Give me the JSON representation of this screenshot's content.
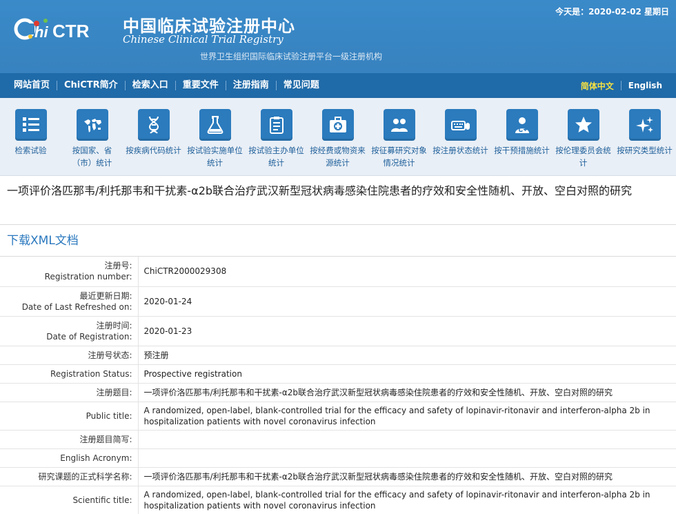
{
  "header": {
    "logo_text": "ChiCTR",
    "title_cn": "中国临床试验注册中心",
    "title_en": "Chinese Clinical Trial Registry",
    "subtitle": "世界卫生组织国际临床试验注册平台一级注册机构",
    "date_line": "今天是：2020-02-02 星期日"
  },
  "nav": {
    "items": [
      "网站首页",
      "ChiCTR简介",
      "检索入口",
      "重要文件",
      "注册指南",
      "常见问题"
    ],
    "lang_cn": "简体中文",
    "lang_en": "English"
  },
  "iconbar": {
    "items": [
      {
        "label": "检索试验",
        "icon": "list-icon"
      },
      {
        "label": "按国家、省（市）统计",
        "icon": "world-map-icon"
      },
      {
        "label": "按疾病代码统计",
        "icon": "dna-icon"
      },
      {
        "label": "按试验实施单位统计",
        "icon": "flask-icon"
      },
      {
        "label": "按试验主办单位统计",
        "icon": "clipboard-icon"
      },
      {
        "label": "按经费或物资来源统计",
        "icon": "medkit-icon"
      },
      {
        "label": "按征募研究对象情况统计",
        "icon": "people-icon"
      },
      {
        "label": "按注册状态统计",
        "icon": "keyboard-mouse-icon"
      },
      {
        "label": "按干预措施统计",
        "icon": "doctor-icon"
      },
      {
        "label": "按伦理委员会统计",
        "icon": "star-icon"
      },
      {
        "label": "按研究类型统计",
        "icon": "sparkle-icon"
      }
    ]
  },
  "page": {
    "title": "一项评价洛匹那韦/利托那韦和干扰素-α2b联合治疗武汉新型冠状病毒感染住院患者的疗效和安全性随机、开放、空白对照的研究",
    "download_label": "下载XML文档"
  },
  "rows": [
    {
      "label_cn": "注册号:",
      "label_en": "Registration number:",
      "value": "ChiCTR2000029308"
    },
    {
      "label_cn": "最近更新日期:",
      "label_en": "Date of Last Refreshed on:",
      "value": "2020-01-24"
    },
    {
      "label_cn": "注册时间:",
      "label_en": "Date of Registration:",
      "value": "2020-01-23"
    },
    {
      "label_cn": "注册号状态:",
      "label_en": "",
      "value": "预注册"
    },
    {
      "label_cn": "",
      "label_en": "Registration Status:",
      "value": "Prospective registration"
    },
    {
      "label_cn": "注册题目:",
      "label_en": "",
      "value": "一项评价洛匹那韦/利托那韦和干扰素-α2b联合治疗武汉新型冠状病毒感染住院患者的疗效和安全性随机、开放、空白对照的研究"
    },
    {
      "label_cn": "",
      "label_en": "Public title:",
      "value": "A randomized, open-label, blank-controlled trial for the efficacy and safety of lopinavir-ritonavir and interferon-alpha 2b in hospitalization patients with novel coronavirus infection"
    },
    {
      "label_cn": "注册题目简写:",
      "label_en": "",
      "value": ""
    },
    {
      "label_cn": "",
      "label_en": "English Acronym:",
      "value": ""
    },
    {
      "label_cn": "研究课题的正式科学名称:",
      "label_en": "",
      "value": "一项评价洛匹那韦/利托那韦和干扰素-α2b联合治疗武汉新型冠状病毒感染住院患者的疗效和安全性随机、开放、空白对照的研究"
    },
    {
      "label_cn": "",
      "label_en": "Scientific title:",
      "value": "A randomized, open-label, blank-controlled trial for the efficacy and safety of lopinavir-ritonavir and interferon-alpha 2b in hospitalization patients with novel coronavirus infection"
    }
  ]
}
